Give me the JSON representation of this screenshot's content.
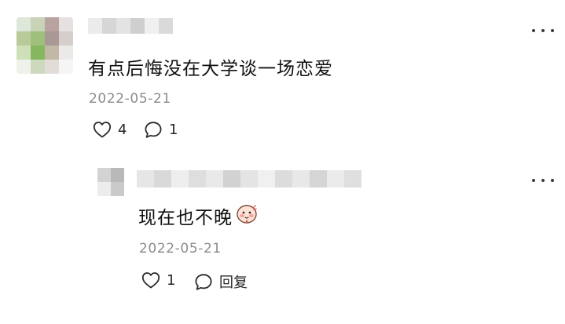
{
  "comment": {
    "text": "有点后悔没在大学谈一场恋爱",
    "date": "2022-05-21",
    "like_count": "4",
    "reply_count": "1"
  },
  "reply": {
    "text": "现在也不晚",
    "date": "2022-05-21",
    "like_count": "1",
    "reply_label": "回复"
  },
  "emoji": "blushing-face-emoji",
  "icons": {
    "like": "heart-outline-icon",
    "comment": "speech-bubble-icon",
    "more": "more-dots-icon"
  }
}
